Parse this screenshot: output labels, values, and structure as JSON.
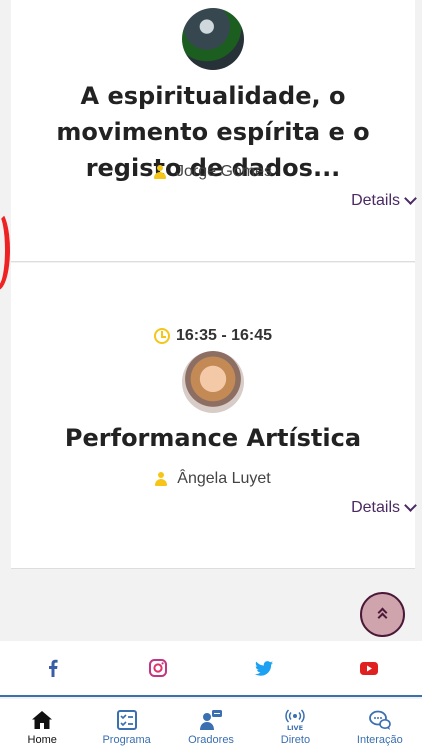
{
  "session1": {
    "title": "A espiritualidade, o movimento espírita e o registo de dados...",
    "speaker": "Jorge Gomes",
    "details_label": "Details"
  },
  "session2": {
    "time": "16:35 - 16:45",
    "title": "Performance Artística",
    "speaker": "Ângela Luyet",
    "details_label": "Details"
  },
  "social": [
    "facebook-icon",
    "instagram-icon",
    "twitter-icon",
    "youtube-icon"
  ],
  "nav": {
    "items": [
      {
        "label": "Home",
        "icon": "home-icon",
        "active": true
      },
      {
        "label": "Programa",
        "icon": "checklist-icon"
      },
      {
        "label": "Oradores",
        "icon": "speaker-icon"
      },
      {
        "label": "Direto",
        "icon": "live-icon"
      },
      {
        "label": "Interação",
        "icon": "chat-icon"
      }
    ]
  },
  "colors": {
    "accent": "#f5c518",
    "details": "#4b2a63",
    "nav_blue": "#3a6fb0",
    "scroll_button": "#cfa4ad"
  }
}
